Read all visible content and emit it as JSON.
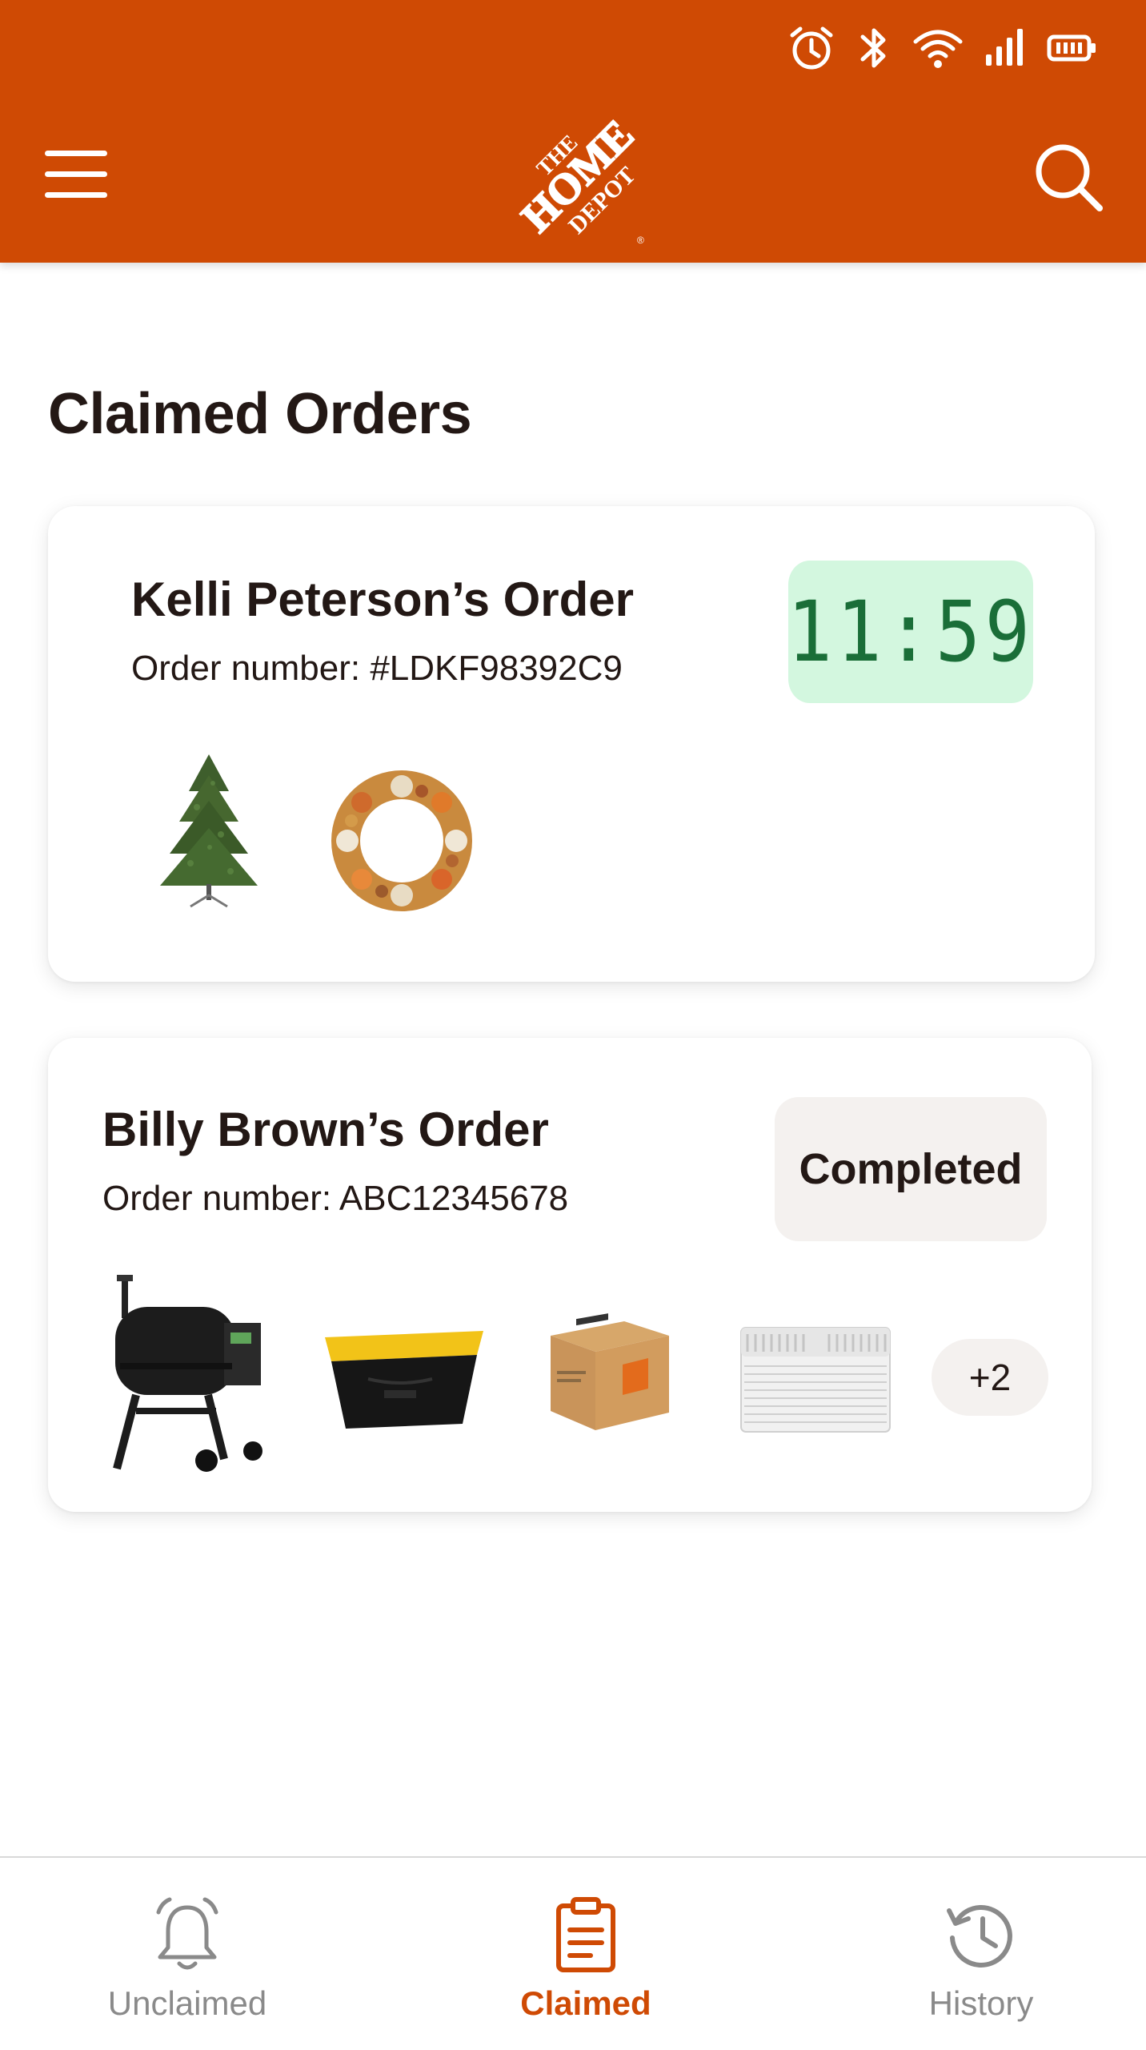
{
  "colors": {
    "brand": "#cf4a04",
    "timer_bg": "#d3f7df",
    "timer_text": "#1a6e38",
    "badge_bg": "#f4f1ef",
    "nav_inactive": "#8a8a8a"
  },
  "status_bar": {
    "icons": [
      "alarm-icon",
      "bluetooth-icon",
      "wifi-icon",
      "signal-icon",
      "battery-icon"
    ]
  },
  "header": {
    "logo_lines": [
      "THE",
      "HOME",
      "DEPOT"
    ]
  },
  "page": {
    "title": "Claimed Orders"
  },
  "orders": [
    {
      "name": "Kelli Peterson’s Order",
      "order_number": "Order number: #LDKF98392C9",
      "timer": "11:59",
      "products": [
        "christmas-tree",
        "autumn-wreath"
      ]
    },
    {
      "name": "Billy Brown’s Order",
      "order_number": "Order number: ABC12345678",
      "status": "Completed",
      "products": [
        "pellet-grill",
        "storage-tote",
        "moving-box",
        "window-air-conditioner"
      ],
      "more_count": "+2"
    }
  ],
  "bottom_nav": {
    "items": [
      {
        "label": "Unclaimed",
        "icon": "bell-icon",
        "active": false
      },
      {
        "label": "Claimed",
        "icon": "clipboard-icon",
        "active": true
      },
      {
        "label": "History",
        "icon": "history-icon",
        "active": false
      }
    ]
  }
}
